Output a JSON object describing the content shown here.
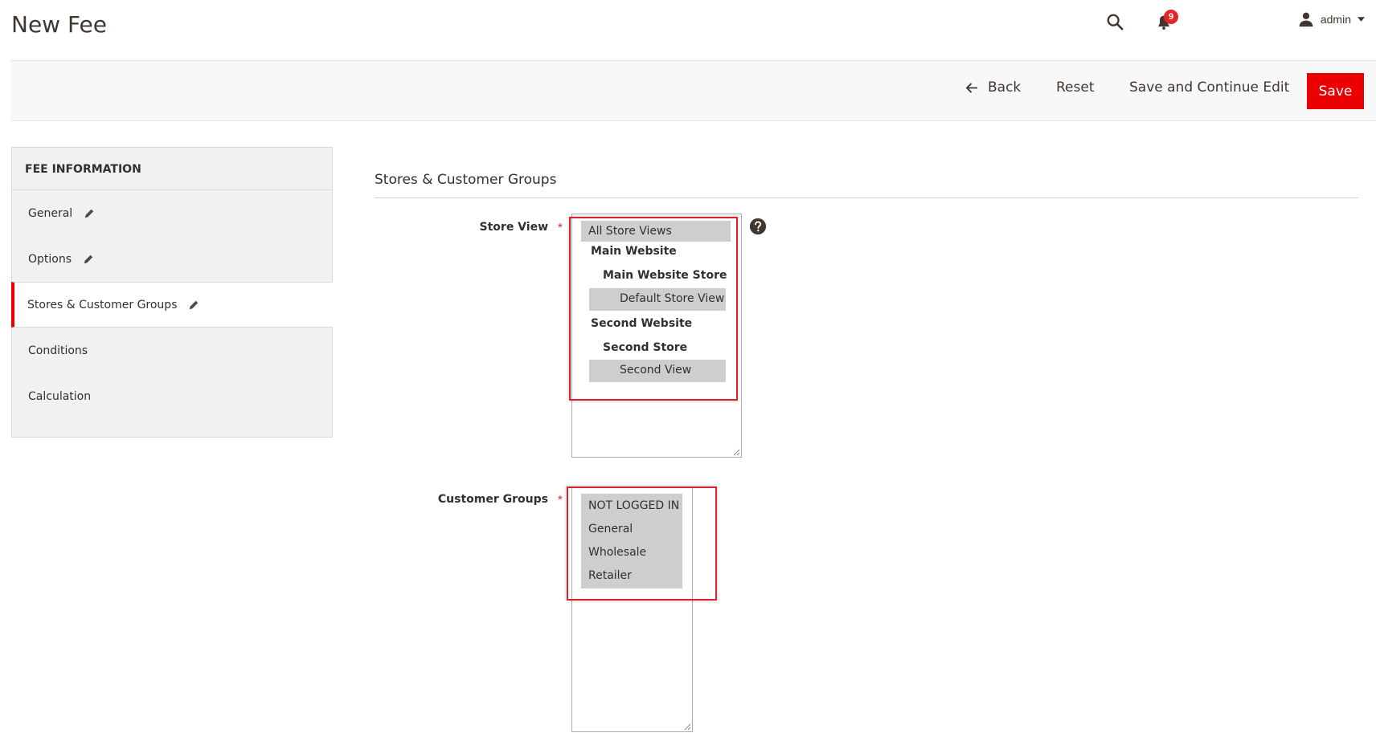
{
  "header": {
    "title": "New Fee",
    "notification_count": "9",
    "user_name": "admin"
  },
  "toolbar": {
    "back_label": "Back",
    "reset_label": "Reset",
    "save_continue_label": "Save and Continue Edit",
    "save_label": "Save"
  },
  "sidebar": {
    "heading": "FEE INFORMATION",
    "items": [
      {
        "label": "General",
        "edited": true
      },
      {
        "label": "Options",
        "edited": true
      },
      {
        "label": "Stores & Customer Groups",
        "edited": true,
        "active": true
      },
      {
        "label": "Conditions",
        "edited": false
      },
      {
        "label": "Calculation",
        "edited": false
      }
    ]
  },
  "main": {
    "section_title": "Stores & Customer Groups",
    "store_view": {
      "label": "Store View",
      "required_mark": "*",
      "options": {
        "all": "All Store Views",
        "website1": "Main Website",
        "store1": "Main Website Store",
        "view1": "Default Store View",
        "website2": "Second Website",
        "store2": "Second Store",
        "view2": "Second View"
      }
    },
    "customer_groups": {
      "label": "Customer Groups",
      "required_mark": "*",
      "options": [
        "NOT LOGGED IN",
        "General",
        "Wholesale",
        "Retailer"
      ]
    }
  },
  "colors": {
    "accent": "#eb0000",
    "highlight": "#d9232e",
    "selected_option": "#cecece"
  }
}
